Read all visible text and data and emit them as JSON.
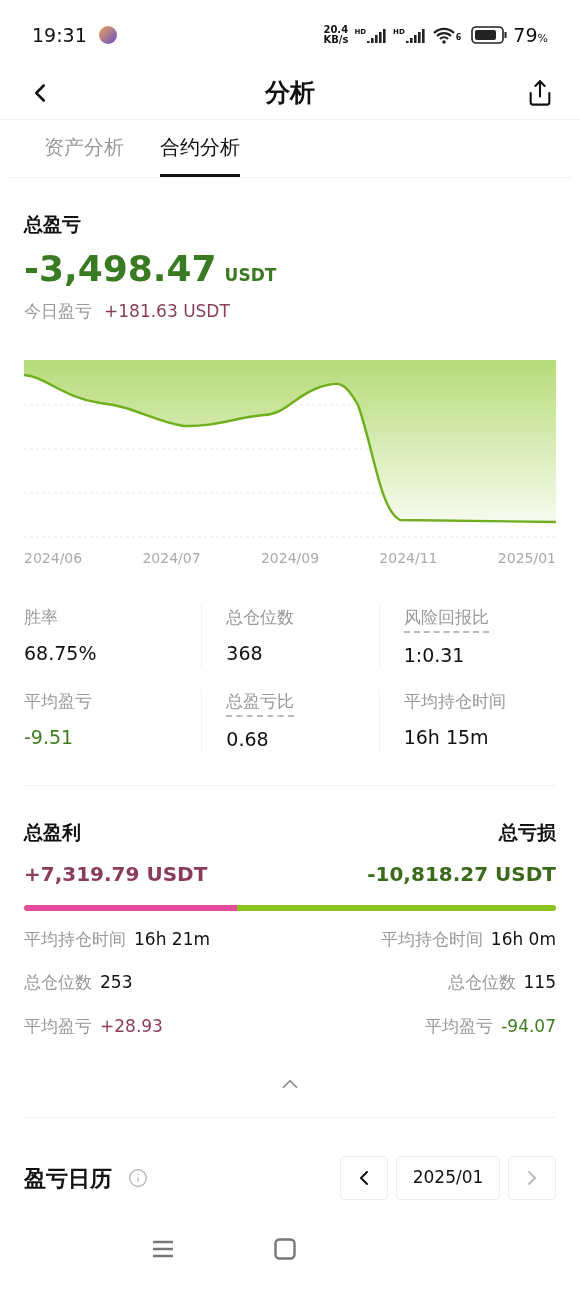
{
  "status_bar": {
    "time": "19:31",
    "speed_value": "20.4",
    "speed_unit": "KB/s",
    "network_labels": [
      "HD",
      "HD"
    ],
    "wifi_band": "6",
    "battery_value": "79",
    "battery_unit": "%"
  },
  "header": {
    "title": "分析"
  },
  "tabs": [
    {
      "label": "资产分析",
      "selected": false
    },
    {
      "label": "合约分析",
      "selected": true
    }
  ],
  "summary": {
    "title": "总盈亏",
    "amount": "-3,498.47",
    "unit": "USDT",
    "today_label": "今日盈亏",
    "today_value": "+181.63 USDT"
  },
  "chart": {
    "x_labels": [
      "2024/06",
      "2024/07",
      "2024/09",
      "2024/11",
      "2025/01"
    ]
  },
  "stats": [
    {
      "label": "胜率",
      "value": "68.75%",
      "underlined": false,
      "color": "#111111"
    },
    {
      "label": "总仓位数",
      "value": "368",
      "underlined": false,
      "color": "#111111"
    },
    {
      "label": "风险回报比",
      "value": "1:0.31",
      "underlined": true,
      "color": "#111111"
    },
    {
      "label": "平均盈亏",
      "value": "-9.51",
      "underlined": false,
      "color": "#3f7d1f"
    },
    {
      "label": "总盈亏比",
      "value": "0.68",
      "underlined": true,
      "color": "#111111"
    },
    {
      "label": "平均持仓时间",
      "value": "16h 15m",
      "underlined": false,
      "color": "#111111"
    }
  ],
  "split": {
    "profit_title": "总盈利",
    "loss_title": "总亏损",
    "profit_value": "+7,319.79 USDT",
    "loss_value": "-10,818.27 USDT",
    "level": 0.4,
    "profit_rows": [
      {
        "label": "平均持仓时间",
        "value": "16h 21m",
        "color": "#111111"
      },
      {
        "label": "总仓位数",
        "value": "253",
        "color": "#111111"
      },
      {
        "label": "平均盈亏",
        "value": "+28.93",
        "color": "#8a3c5c"
      }
    ],
    "loss_rows": [
      {
        "label": "平均持仓时间",
        "value": "16h 0m",
        "color": "#111111"
      },
      {
        "label": "总仓位数",
        "value": "115",
        "color": "#111111"
      },
      {
        "label": "平均盈亏",
        "value": "-94.07",
        "color": "#3f7d1f"
      }
    ]
  },
  "calendar": {
    "title": "盈亏日历",
    "month": "2025/01",
    "prev_disabled": false,
    "next_disabled": true
  }
}
